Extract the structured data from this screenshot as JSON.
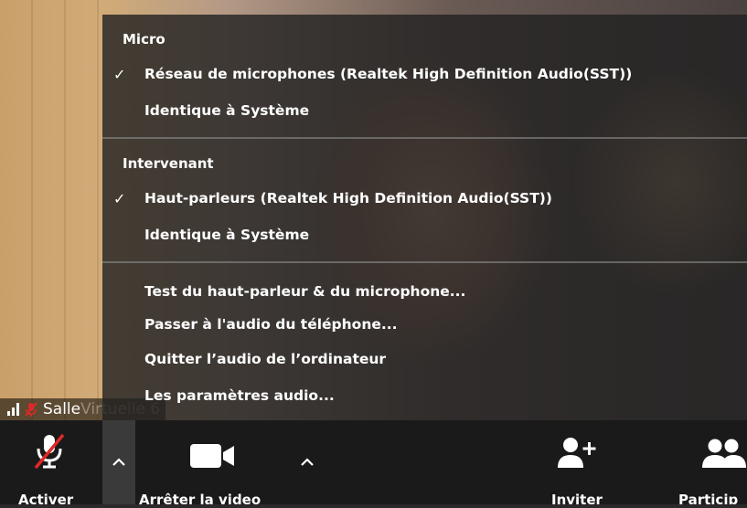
{
  "video": {
    "participant_name": "Salle",
    "participant_name_faded": "Virtuelle 6"
  },
  "audio_menu": {
    "micro_header": "Micro",
    "micro_options": [
      {
        "label": "Réseau de microphones (Realtek High Definition Audio(SST))",
        "checked": true
      },
      {
        "label": "Identique à Système",
        "checked": false
      }
    ],
    "speaker_header": "Intervenant",
    "speaker_options": [
      {
        "label": "Haut-parleurs (Realtek High Definition Audio(SST))",
        "checked": true
      },
      {
        "label": "Identique à Système",
        "checked": false
      }
    ],
    "actions": [
      "Test du haut-parleur & du microphone...",
      "Passer à l'audio du téléphone...",
      "Quitter l’audio de l’ordinateur",
      "Les paramètres audio..."
    ],
    "check_glyph": "✓"
  },
  "toolbar": {
    "unmute_label": "Activer",
    "stop_video_label": "Arrêter la video",
    "invite_label": "Inviter",
    "participants_label": "Particip"
  },
  "icons": {
    "mic_muted": "microphone-muted-icon",
    "camera": "video-camera-icon",
    "add_user": "add-user-icon",
    "participants": "participants-icon",
    "caret_up": "chevron-up-icon",
    "signal": "signal-strength-icon"
  },
  "colors": {
    "muted_red": "#e02828",
    "menu_bg": "rgba(32,32,32,0.80)",
    "toolbar_bg": "#1a1a1a",
    "caret_active_bg": "#3a3a3a"
  }
}
